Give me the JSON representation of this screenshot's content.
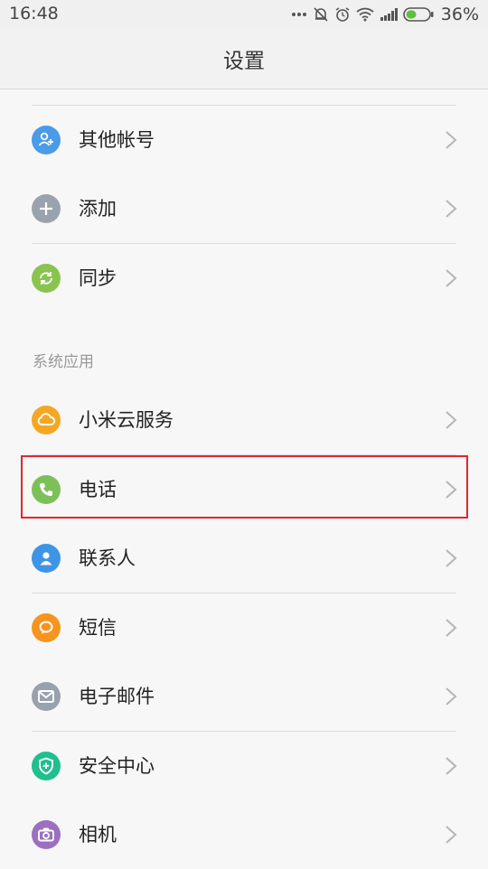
{
  "status": {
    "time": "16:48",
    "battery": "36%"
  },
  "header": {
    "title": "设置"
  },
  "account_items": [
    {
      "label": "其他帐号",
      "icon": "add-user-icon",
      "color": "#4a9be8"
    },
    {
      "label": "添加",
      "icon": "plus-icon",
      "color": "#9aa3ad"
    },
    {
      "label": "同步",
      "icon": "sync-icon",
      "color": "#8ac34f"
    }
  ],
  "section": {
    "title": "系统应用"
  },
  "system_items": [
    {
      "label": "小米云服务",
      "icon": "cloud-icon",
      "color": "#f5a623"
    },
    {
      "label": "电话",
      "icon": "phone-icon",
      "color": "#7cc05a"
    },
    {
      "label": "联系人",
      "icon": "contacts-icon",
      "color": "#3e94e6"
    },
    {
      "label": "短信",
      "icon": "message-icon",
      "color": "#f7941d"
    },
    {
      "label": "电子邮件",
      "icon": "mail-icon",
      "color": "#98a2ad"
    },
    {
      "label": "安全中心",
      "icon": "shield-icon",
      "color": "#1fbf8f"
    },
    {
      "label": "相机",
      "icon": "camera-icon",
      "color": "#9c6fbf"
    }
  ],
  "colors": {
    "highlight": "#e0262f"
  }
}
